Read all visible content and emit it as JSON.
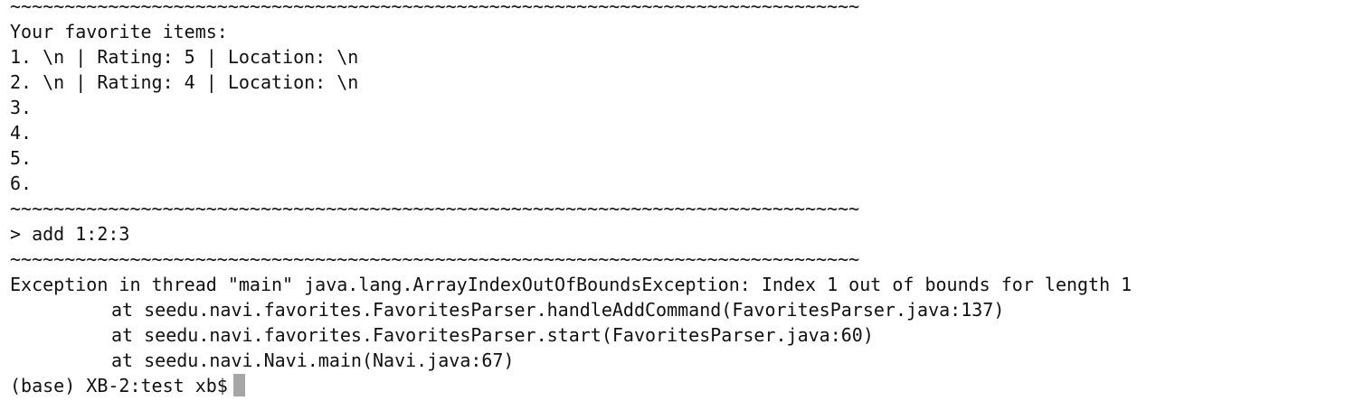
{
  "terminal": {
    "separator": "~~~~~~~~~~~~~~~~~~~~~~~~~~~~~~~~~~~~~~~~~~~~~~~~~~~~~~~~~~~~~~~~~~~~~~~~~~~~~~",
    "favorites_header": "Your favorite items:",
    "favorites": [
      "1. \\n | Rating: 5 | Location: \\n",
      "2. \\n | Rating: 4 | Location: \\n",
      "3.",
      "4.",
      "5.",
      "6."
    ],
    "command_input": "> add 1:2:3",
    "exception": "Exception in thread \"main\" java.lang.ArrayIndexOutOfBoundsException: Index 1 out of bounds for length 1",
    "stack_trace": [
      "at seedu.navi.favorites.FavoritesParser.handleAddCommand(FavoritesParser.java:137)",
      "at seedu.navi.favorites.FavoritesParser.start(FavoritesParser.java:60)",
      "at seedu.navi.Navi.main(Navi.java:67)"
    ],
    "prompt": "(base) XB-2:test xb$"
  }
}
